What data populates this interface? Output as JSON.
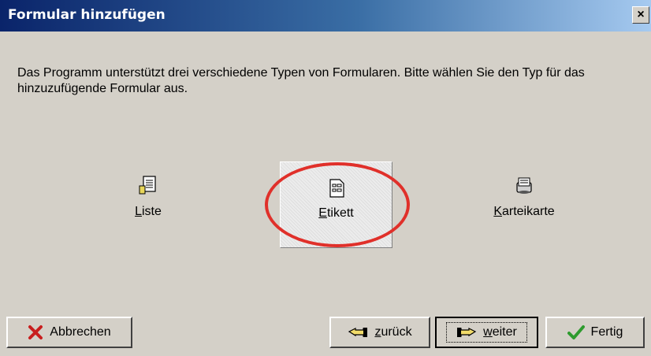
{
  "window": {
    "title": "Formular hinzufügen",
    "close_symbol": "×"
  },
  "description": "Das Programm unterstützt drei verschiedene Typen von Formularen. Bitte wählen Sie den Typ für das hinzuzufügende Formular aus.",
  "types": [
    {
      "mnemonic": "L",
      "rest": "iste",
      "icon": "list-document-icon"
    },
    {
      "mnemonic": "E",
      "rest": "tikett",
      "icon": "label-document-icon",
      "selected": true
    },
    {
      "mnemonic": "K",
      "rest": "arteikarte",
      "icon": "card-file-icon"
    }
  ],
  "buttons": {
    "abbrechen": {
      "label": "Abbrechen",
      "icon": "red-x-icon"
    },
    "zurueck": {
      "mnemonic": "z",
      "rest": "urück",
      "icon": "hand-pointing-left-icon"
    },
    "weiter": {
      "mnemonic": "w",
      "rest": "eiter",
      "icon": "hand-pointing-right-icon"
    },
    "fertig": {
      "label": "Fertig",
      "icon": "green-check-icon"
    }
  },
  "colors": {
    "titlebar_start": "#0a246a",
    "titlebar_end": "#a6caf0",
    "dialog_bg": "#d4d0c8",
    "highlight": "#e0302a"
  }
}
